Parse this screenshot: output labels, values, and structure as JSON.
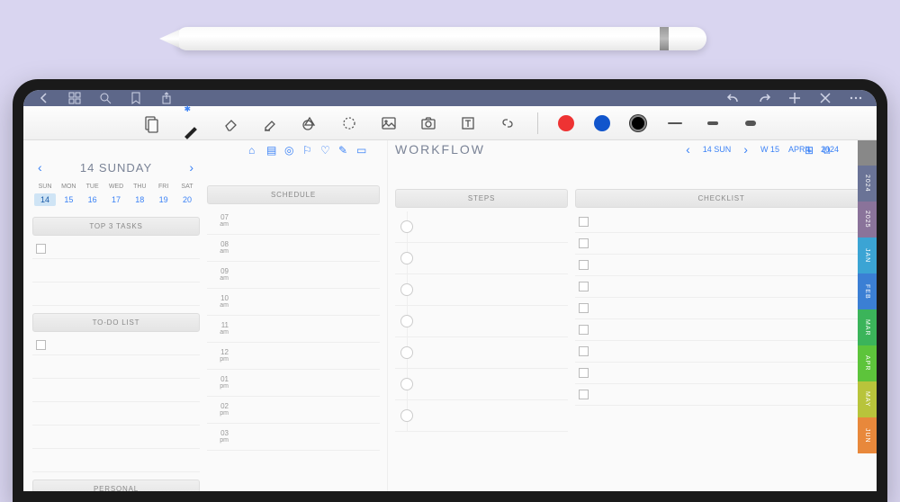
{
  "daily": {
    "title": "14 SUNDAY",
    "weekdays": [
      "SUN",
      "MON",
      "TUE",
      "WED",
      "THU",
      "FRI",
      "SAT"
    ],
    "dates": [
      "14",
      "15",
      "16",
      "17",
      "18",
      "19",
      "20"
    ],
    "selected_index": 0,
    "sections": {
      "top3": "TOP 3 TASKS",
      "todo": "TO-DO LIST",
      "personal": "PERSONAL"
    }
  },
  "schedule": {
    "title": "SCHEDULE",
    "times": [
      {
        "h": "07",
        "p": "am"
      },
      {
        "h": "08",
        "p": "am"
      },
      {
        "h": "09",
        "p": "am"
      },
      {
        "h": "10",
        "p": "am"
      },
      {
        "h": "11",
        "p": "am"
      },
      {
        "h": "12",
        "p": "pm"
      },
      {
        "h": "01",
        "p": "pm"
      },
      {
        "h": "02",
        "p": "pm"
      },
      {
        "h": "03",
        "p": "pm"
      }
    ]
  },
  "workflow": {
    "title": "WORKFLOW",
    "date": "14 SUN",
    "week": "W 15",
    "month": "APRIL",
    "year": "2024",
    "steps_title": "STEPS",
    "checklist_title": "CHECKLIST",
    "step_count": 7,
    "checklist_count": 9
  },
  "tabs": [
    {
      "label": "",
      "cls": "home"
    },
    {
      "label": "2024",
      "cls": "y2024"
    },
    {
      "label": "2025",
      "cls": "y2025"
    },
    {
      "label": "JAN",
      "cls": "jan"
    },
    {
      "label": "FEB",
      "cls": "feb"
    },
    {
      "label": "MAR",
      "cls": "mar"
    },
    {
      "label": "APR",
      "cls": "apr"
    },
    {
      "label": "MAY",
      "cls": "may"
    },
    {
      "label": "JUN",
      "cls": "jun"
    }
  ],
  "colors": {
    "accent": "#3b82f6"
  }
}
